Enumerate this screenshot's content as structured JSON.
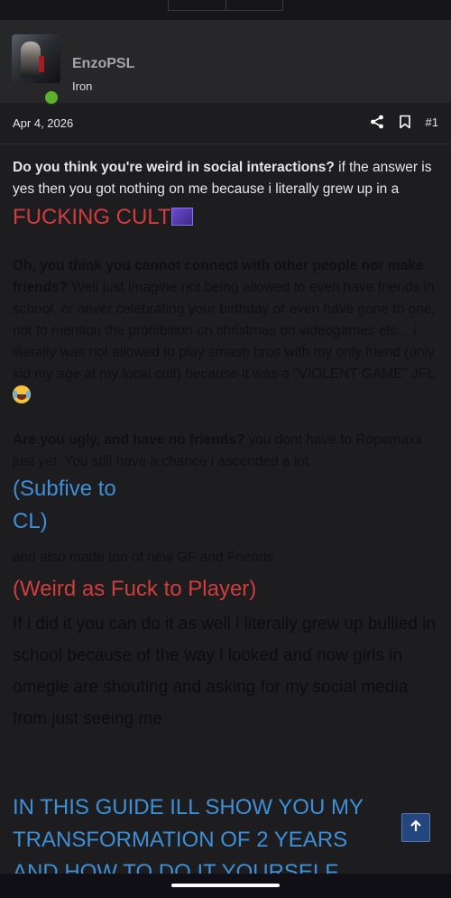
{
  "user": {
    "name": "EnzoPSL",
    "title": "Iron"
  },
  "post": {
    "date": "Apr 4, 2026",
    "number": "#1",
    "p1": {
      "bold": "Do you think you're weird in social interactions?",
      "text": " if the answer is yes then you got nothing on me because i literally grew up in a ",
      "red": "FUCKING CULT"
    },
    "p2": {
      "bold": "Oh, you think you cannot connect with other people nor make friends?",
      "text": " Well just imagine not being allowed to even have friends in school, or never celebrating your birthday or even have gone to one, not to mention the prohibition on christmas on videogames etc... i literally was not allowed to play smash bros with my only friend (only kid my age at my local cult) because it was a \"VIOLENT GAME\" JFL"
    },
    "p3": {
      "bold": "Are you ugly, and have no friends?",
      "text": " you dont have to Ropemaxx just yet. You still have a chance i ascended a lot"
    },
    "blue1_line1": "(Subfive to",
    "blue1_line2": "CL)",
    "small_line": "and also made ton of new GF and Friends",
    "red2": "(Weird as Fuck to Player)",
    "big_text": "If i did it you can do it as well i literally grew up bullied in school because of the way i looked and now girls in omegle are shouting and asking for my social media from just seeing me",
    "guide_line1": "IN THIS GUIDE ILL SHOW YOU MY",
    "guide_line2": "TRANSFORMATION OF 2 YEARS",
    "guide_line3": "AND HOW TO DO IT YOURSELF."
  },
  "icons": {
    "share": "share-icon",
    "bookmark": "bookmark-icon",
    "scroll_top": "arrow-up-icon"
  },
  "colors": {
    "online": "#5db12b",
    "red_text": "#d03d3d",
    "blue_text": "#3f8fd6",
    "scroll_button": "#24467e"
  }
}
